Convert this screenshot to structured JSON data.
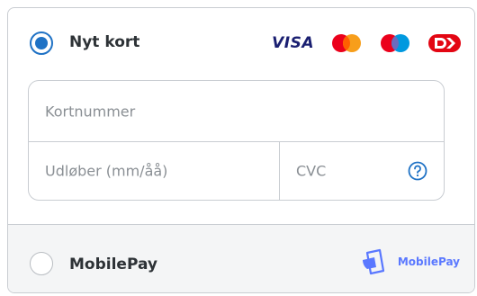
{
  "payment": {
    "card_option": {
      "label": "Nyt kort",
      "selected": true,
      "brands": [
        {
          "name": "VISA",
          "icon": "visa-logo"
        },
        {
          "name": "Mastercard",
          "icon": "mastercard-logo",
          "colors": [
            "#eb001b",
            "#f79e1b"
          ]
        },
        {
          "name": "Maestro",
          "icon": "maestro-logo",
          "colors": [
            "#eb001b",
            "#0099df"
          ]
        },
        {
          "name": "Dankort",
          "icon": "dankort-logo",
          "colors": [
            "#e30613"
          ]
        }
      ],
      "fields": {
        "card_number": {
          "value": "",
          "placeholder": "Kortnummer"
        },
        "expiry": {
          "value": "",
          "placeholder": "Udløber (mm/åå)"
        },
        "cvc": {
          "value": "",
          "placeholder": "CVC"
        }
      },
      "help_icon": "question-circle-icon"
    },
    "mobilepay_option": {
      "label": "MobilePay",
      "selected": false,
      "logo_text": "MobilePay"
    }
  },
  "colors": {
    "accent": "#1f72c5",
    "border": "#c9cdd2",
    "mobilepay": "#5a78ff"
  }
}
